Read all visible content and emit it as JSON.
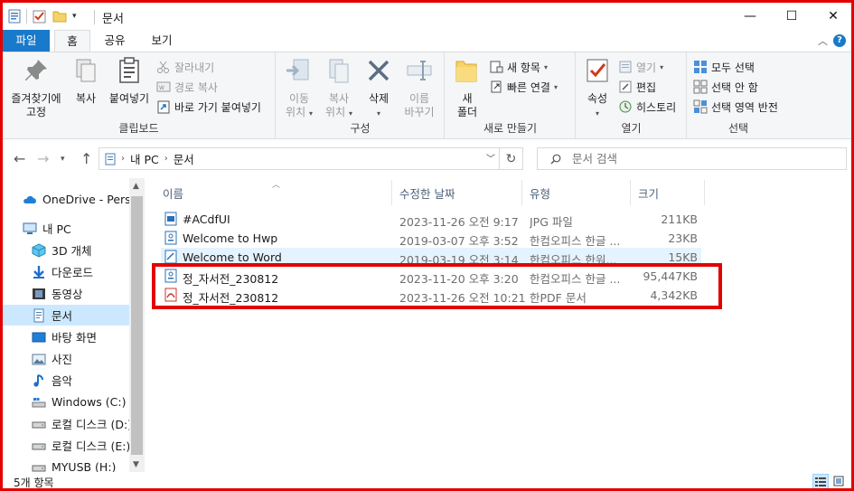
{
  "window": {
    "title": "문서",
    "controls": {
      "minimize": "—",
      "maximize": "☐",
      "close": "✕"
    }
  },
  "ribbon_tabs": [
    {
      "label": "파일"
    },
    {
      "label": "홈"
    },
    {
      "label": "공유"
    },
    {
      "label": "보기"
    }
  ],
  "ribbon": {
    "clipboard": {
      "label": "클립보드",
      "pin_line1": "즐겨찾기에",
      "pin_line2": "고정",
      "copy": "복사",
      "paste": "붙여넣기",
      "cut": "잘라내기",
      "copy_path": "경로 복사",
      "paste_shortcut": "바로 가기 붙여넣기"
    },
    "organize": {
      "label": "구성",
      "move_line1": "이동",
      "move_line2": "위치",
      "copyto_line1": "복사",
      "copyto_line2": "위치",
      "delete": "삭제",
      "rename_line1": "이름",
      "rename_line2": "바꾸기"
    },
    "new": {
      "label": "새로 만들기",
      "folder_line1": "새",
      "folder_line2": "폴더",
      "new_item": "새 항목",
      "easy_access": "빠른 연결"
    },
    "open": {
      "label": "열기",
      "properties": "속성",
      "open": "열기",
      "edit": "편집",
      "history": "히스토리"
    },
    "select": {
      "label": "선택",
      "select_all": "모두 선택",
      "select_none": "선택 안 함",
      "invert": "선택 영역 반전"
    }
  },
  "address": {
    "crumbs": [
      "내 PC",
      "문서"
    ],
    "search_placeholder": "문서 검색"
  },
  "nav": [
    {
      "label": "OneDrive - Person",
      "icon": "cloud-icon"
    },
    {
      "label": "내 PC",
      "icon": "pc-icon"
    },
    {
      "label": "3D 개체",
      "icon": "cube-icon"
    },
    {
      "label": "다운로드",
      "icon": "download-icon"
    },
    {
      "label": "동영상",
      "icon": "video-icon"
    },
    {
      "label": "문서",
      "icon": "documents-icon"
    },
    {
      "label": "바탕 화면",
      "icon": "desktop-icon"
    },
    {
      "label": "사진",
      "icon": "pictures-icon"
    },
    {
      "label": "음악",
      "icon": "music-icon"
    },
    {
      "label": "Windows (C:)",
      "icon": "drive-c-icon"
    },
    {
      "label": "로컬 디스크 (D:)",
      "icon": "drive-icon"
    },
    {
      "label": "로컬 디스크 (E:)",
      "icon": "drive-icon"
    },
    {
      "label": "MYUSB (H:)",
      "icon": "usb-drive-icon"
    }
  ],
  "columns": {
    "name": "이름",
    "date": "수정한 날짜",
    "type": "유형",
    "size": "크기"
  },
  "files": [
    {
      "name": "#ACdfUI",
      "date": "2023-11-26 오전 9:17",
      "type": "JPG 파일",
      "size": "211KB",
      "icon": "image-file-icon"
    },
    {
      "name": "Welcome to Hwp",
      "date": "2019-03-07 오후 3:52",
      "type": "한컴오피스 한글 ...",
      "size": "23KB",
      "icon": "hwp-file-icon"
    },
    {
      "name": "Welcome to Word",
      "date": "2019-03-19 오전 3:14",
      "type": "한컴오피스 한워...",
      "size": "15KB",
      "icon": "hword-file-icon"
    },
    {
      "name": "정_자서전_230812",
      "date": "2023-11-20 오후 3:20",
      "type": "한컴오피스 한글 ...",
      "size": "95,447KB",
      "icon": "hwp-file-icon"
    },
    {
      "name": "정_자서전_230812",
      "date": "2023-11-26 오전 10:21",
      "type": "한PDF 문서",
      "size": "4,342KB",
      "icon": "pdf-file-icon"
    }
  ],
  "status": {
    "count": "5개 항목"
  },
  "colors": {
    "accent": "#1979ca",
    "highlight": "#e30000",
    "selected": "#cce8ff"
  }
}
